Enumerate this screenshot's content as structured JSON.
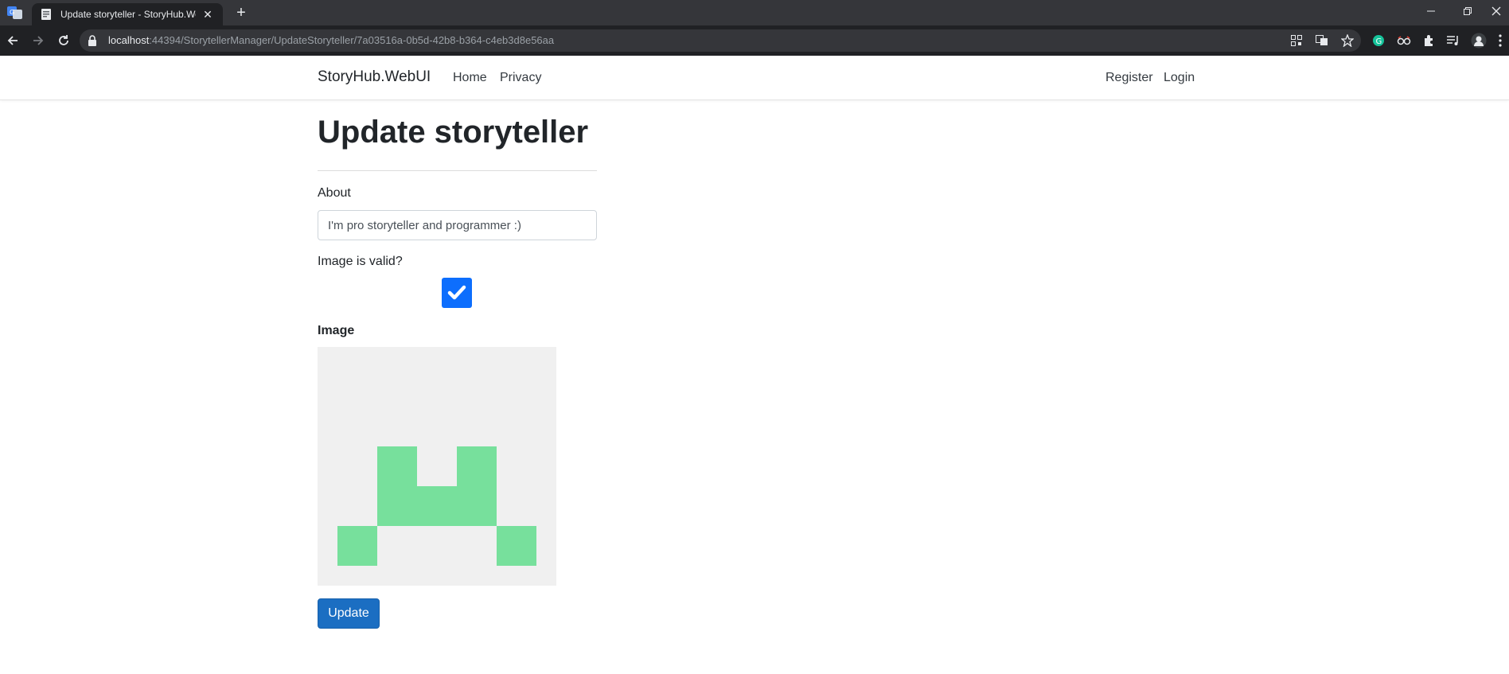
{
  "browser": {
    "tab_title": "Update storyteller - StoryHub.WebUI",
    "tab_close": "✕",
    "new_tab": "+",
    "url_host": "localhost",
    "url_path": ":44394/StorytellerManager/UpdateStoryteller/7a03516a-0b5d-42b8-b364-c4eb3d8e56aa"
  },
  "nav": {
    "brand": "StoryHub.WebUI",
    "left_links": [
      "Home",
      "Privacy"
    ],
    "right_links": [
      "Register",
      "Login"
    ]
  },
  "page": {
    "title": "Update storyteller",
    "about_label": "About",
    "about_value": "I'm pro storyteller and programmer :)",
    "valid_label": "Image is valid?",
    "image_valid": true,
    "image_label": "Image",
    "update_button": "Update"
  },
  "colors": {
    "identicon_fill": "#77e09c",
    "identicon_bg": "#f0f0f0",
    "primary": "#1b6ec2",
    "checkbox": "#0d6efd"
  }
}
